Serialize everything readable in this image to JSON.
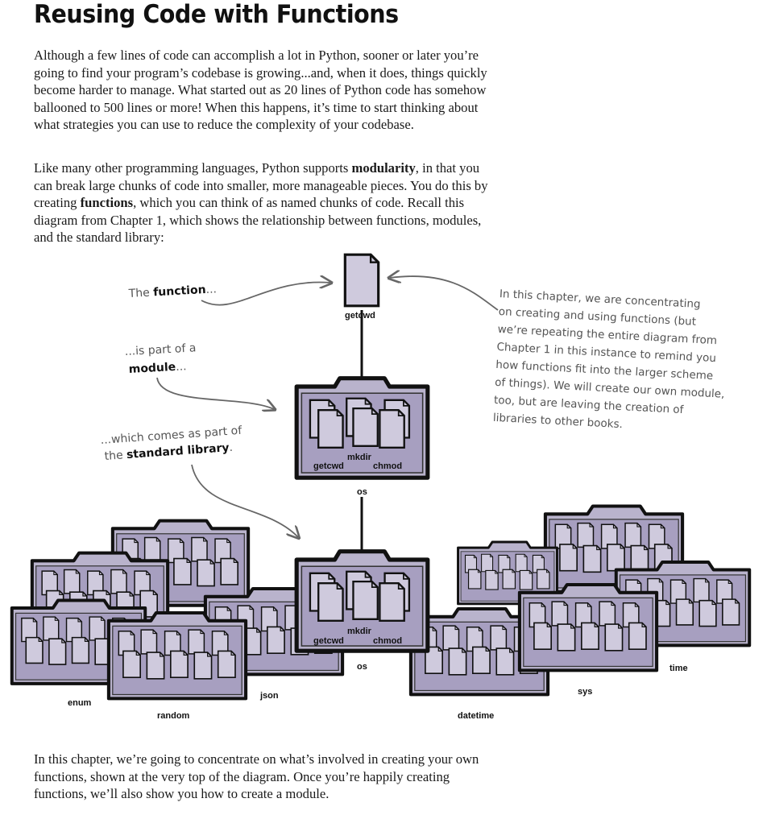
{
  "heading": "Reusing Code with Functions",
  "para1": "Although a few lines of code can accomplish a lot in Python, sooner or later you’re going to find your program’s codebase is growing...and, when it does, things quickly become harder to manage. What started out as 20 lines of Python code has somehow ballooned to 500 lines or more! When this happens, it’s time to start thinking about what strategies you can use to reduce the complexity of your codebase.",
  "para2": {
    "a": "Like many other programming languages, Python supports ",
    "b": "modularity",
    "c": ", in that you can break large chunks of code into smaller, more manageable pieces. You do this by creating ",
    "d": "functions",
    "e": ", which you can think of as named chunks of code. Recall this diagram from Chapter 1, which shows the relationship between functions, modules, and the standard library:"
  },
  "para3": "In this chapter, we’re going to concentrate on what’s involved in creating your own functions, shown at the very top of the diagram. Once you’re happily creating functions, we’ll also show you how to create a module.",
  "annotations": {
    "function_pre": "The ",
    "function_word": "function",
    "function_post": "...",
    "module_line1": "...is part of a",
    "module_word": "module",
    "module_post": "...",
    "library_line1": "...which comes as part of",
    "library_pre": "the ",
    "library_word": "standard library",
    "library_post": ".",
    "chapter_note": [
      "In this chapter, we are concentrating",
      "on creating and using functions (but",
      "we’re repeating the entire diagram from",
      "Chapter 1 in this instance to remind you",
      "how functions fit into the larger scheme",
      "of things). We will create our own module,",
      "too, but are leaving the creation of",
      "libraries to other books."
    ]
  },
  "labels": {
    "top_function": "getcwd",
    "mod_files": [
      "getcwd",
      "mkdir",
      "chmod"
    ],
    "mod_name": "os",
    "library_modules": [
      "enum",
      "random",
      "json",
      "os",
      "datetime",
      "sys",
      "time"
    ]
  },
  "colors": {
    "folder_fill": "#b9b3cc",
    "folder_dark": "#9b93b5",
    "paper": "#cfcadd",
    "ink": "#111111"
  },
  "icons": [
    "function-file-icon",
    "module-folder-icon",
    "library-folder-icon"
  ]
}
